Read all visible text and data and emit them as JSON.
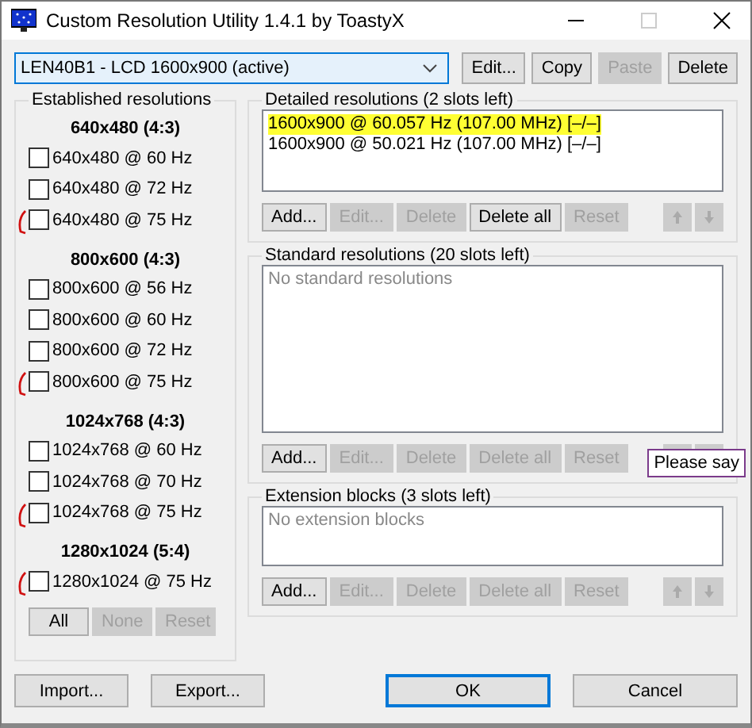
{
  "window": {
    "title": "Custom Resolution Utility 1.4.1 by ToastyX"
  },
  "device": {
    "value": "LEN40B1 - LCD 1600x900 (active)"
  },
  "device_buttons": [
    {
      "label": "Edit...",
      "disabled": false
    },
    {
      "label": "Copy",
      "disabled": false
    },
    {
      "label": "Paste",
      "disabled": true
    },
    {
      "label": "Delete",
      "disabled": false
    }
  ],
  "established": {
    "title": "Established resolutions",
    "groups": [
      {
        "heading": "640x480 (4:3)",
        "items": [
          {
            "label": "640x480 @ 60 Hz",
            "checked": false,
            "marked": false
          },
          {
            "label": "640x480 @ 72 Hz",
            "checked": false,
            "marked": false
          },
          {
            "label": "640x480 @ 75 Hz",
            "checked": false,
            "marked": true
          }
        ]
      },
      {
        "heading": "800x600 (4:3)",
        "items": [
          {
            "label": "800x600 @ 56 Hz",
            "checked": false,
            "marked": false
          },
          {
            "label": "800x600 @ 60 Hz",
            "checked": false,
            "marked": false
          },
          {
            "label": "800x600 @ 72 Hz",
            "checked": false,
            "marked": false
          },
          {
            "label": "800x600 @ 75 Hz",
            "checked": false,
            "marked": true
          }
        ]
      },
      {
        "heading": "1024x768 (4:3)",
        "items": [
          {
            "label": "1024x768 @ 60 Hz",
            "checked": false,
            "marked": false
          },
          {
            "label": "1024x768 @ 70 Hz",
            "checked": false,
            "marked": false
          },
          {
            "label": "1024x768 @ 75 Hz",
            "checked": false,
            "marked": true
          }
        ]
      },
      {
        "heading": "1280x1024 (5:4)",
        "items": [
          {
            "label": "1280x1024 @ 75 Hz",
            "checked": false,
            "marked": true
          }
        ]
      }
    ],
    "buttons": [
      {
        "label": "All",
        "disabled": false
      },
      {
        "label": "None",
        "disabled": true
      },
      {
        "label": "Reset",
        "disabled": true
      }
    ]
  },
  "sections": [
    {
      "title": "Detailed resolutions (2 slots left)",
      "entries": [
        {
          "text": "1600x900 @ 60.057 Hz (107.00 MHz) [–/–]",
          "highlighted": true
        },
        {
          "text": "1600x900 @ 50.021 Hz (107.00 MHz) [–/–]",
          "highlighted": false
        }
      ],
      "buttons": [
        {
          "label": "Add...",
          "disabled": false
        },
        {
          "label": "Edit...",
          "disabled": true
        },
        {
          "label": "Delete",
          "disabled": true
        },
        {
          "label": "Delete all",
          "disabled": false
        },
        {
          "label": "Reset",
          "disabled": true
        }
      ],
      "arrows": [
        {
          "kind": "up",
          "disabled": true
        },
        {
          "kind": "down",
          "disabled": true
        }
      ]
    },
    {
      "title": "Standard resolutions (20 slots left)",
      "placeholder": "No standard resolutions",
      "buttons": [
        {
          "label": "Add...",
          "disabled": false
        },
        {
          "label": "Edit...",
          "disabled": true
        },
        {
          "label": "Delete",
          "disabled": true
        },
        {
          "label": "Delete all",
          "disabled": true
        },
        {
          "label": "Reset",
          "disabled": true
        }
      ],
      "arrows": [
        {
          "kind": "covered",
          "disabled": true
        },
        {
          "kind": "covered",
          "disabled": true
        }
      ],
      "tooltip": "Please say"
    },
    {
      "title": "Extension blocks (3 slots left)",
      "placeholder": "No extension blocks",
      "buttons": [
        {
          "label": "Add...",
          "disabled": false
        },
        {
          "label": "Edit...",
          "disabled": true
        },
        {
          "label": "Delete",
          "disabled": true
        },
        {
          "label": "Delete all",
          "disabled": true
        },
        {
          "label": "Reset",
          "disabled": true
        }
      ],
      "arrows": [
        {
          "kind": "up",
          "disabled": true
        },
        {
          "kind": "down",
          "disabled": true
        }
      ]
    }
  ],
  "bottom_left": [
    {
      "label": "Import...",
      "default": false
    },
    {
      "label": "Export...",
      "default": false
    }
  ],
  "bottom_right": [
    {
      "label": "OK",
      "default": true
    },
    {
      "label": "Cancel",
      "default": false
    }
  ]
}
